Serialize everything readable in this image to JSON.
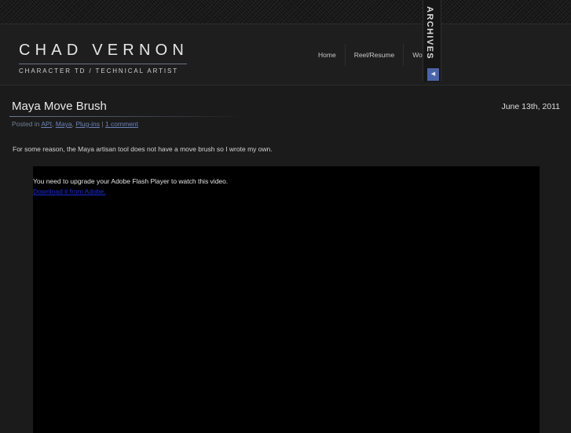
{
  "site": {
    "name": "CHAD VERNON",
    "tagline": "CHARACTER TD / TECHNICAL ARTIST"
  },
  "nav": {
    "items": [
      {
        "label": "Home"
      },
      {
        "label": "Reel/Resume"
      },
      {
        "label": "Wor"
      }
    ]
  },
  "archives": {
    "label": "ARCHIVES",
    "toggle_glyph": "◀",
    "toggle_icon": "arrow-left-icon"
  },
  "post": {
    "title": "Maya Move Brush",
    "date": "June 13th, 2011",
    "meta": {
      "prefix": "Posted in ",
      "categories": [
        "API",
        "Maya",
        "Plug-ins"
      ],
      "sep1": ", ",
      "sep2": ", ",
      "pipe": " | ",
      "comments": "1 comment"
    },
    "body": "For some reason, the Maya artisan tool does not have a move brush so I wrote my own.",
    "video": {
      "message": "You need to upgrade your Adobe Flash Player to watch this video.",
      "link": "Download it from Adobe."
    }
  },
  "colors": {
    "background": "#1b1b1b",
    "accent_blue": "#4a64a8",
    "link": "#6a82b8"
  }
}
